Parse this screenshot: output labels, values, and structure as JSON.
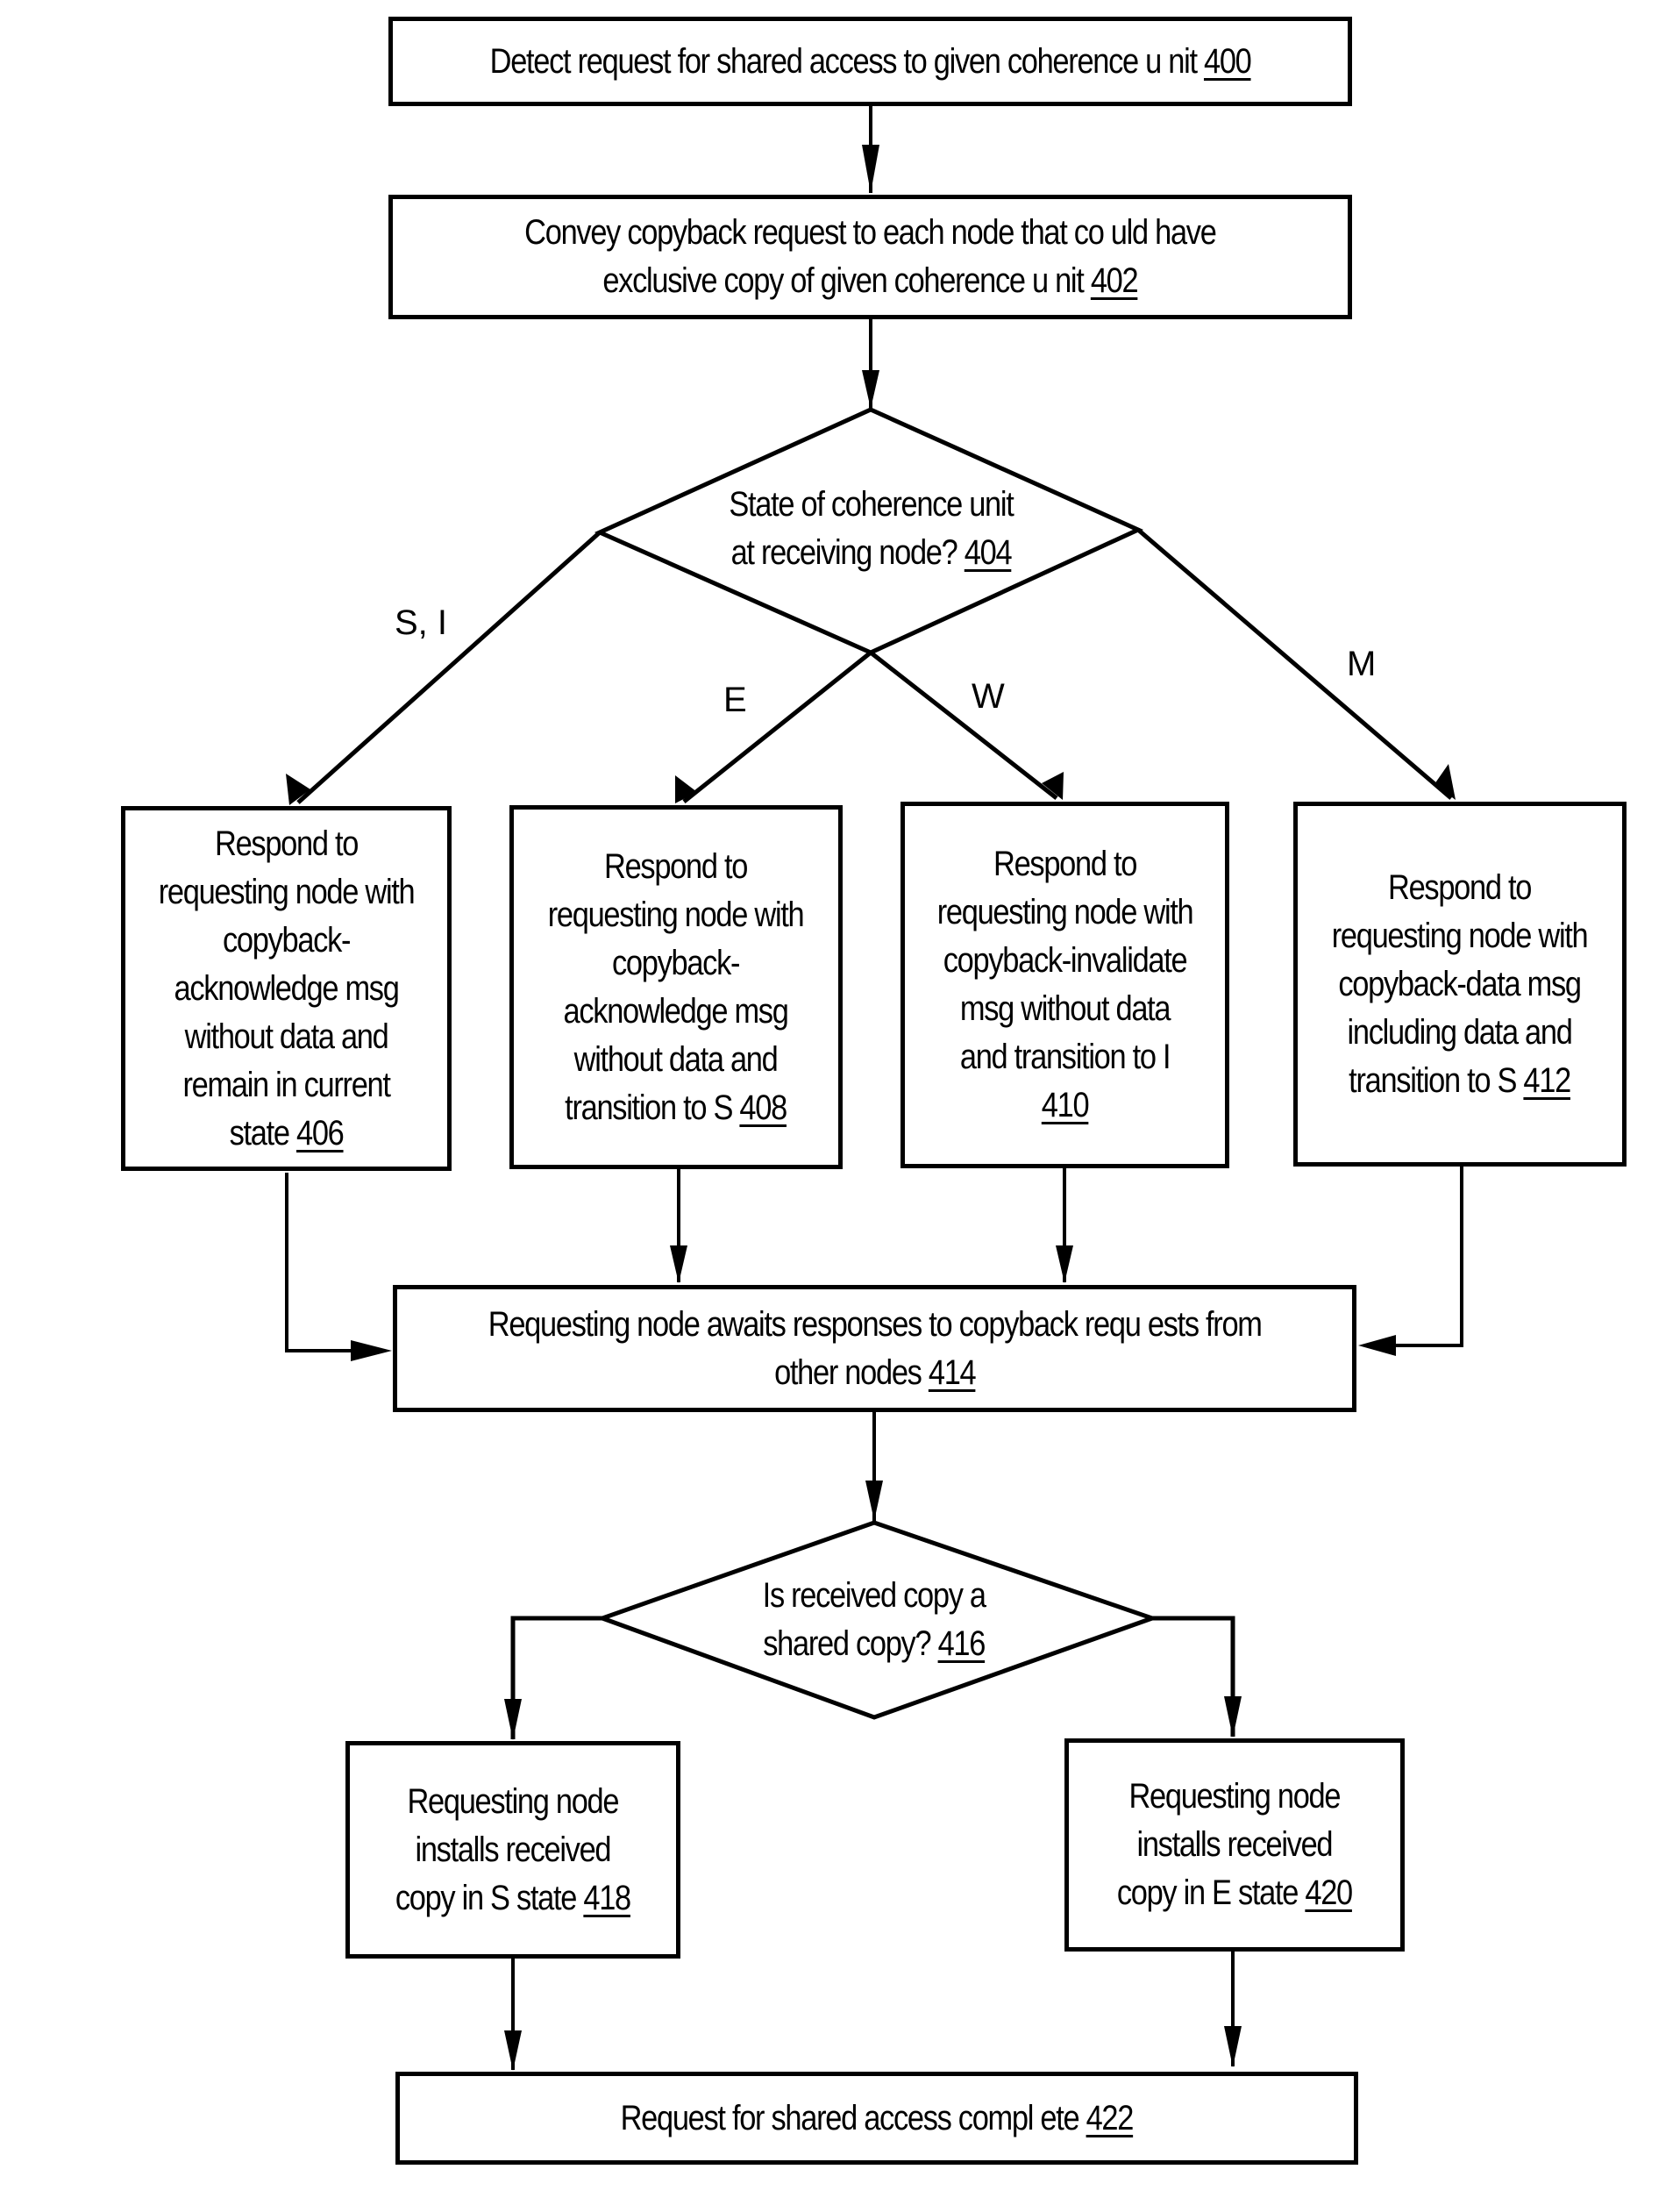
{
  "diagram": {
    "type": "flowchart",
    "nodes": [
      {
        "id": "400",
        "shape": "process",
        "text": "Detect request for shared access to given coherence u nit ",
        "ref": "400"
      },
      {
        "id": "402",
        "shape": "process",
        "text_lines": [
          "Convey copyback request to each node that co uld have",
          "exclusive copy of given coherence u nit "
        ],
        "ref": "402"
      },
      {
        "id": "404",
        "shape": "decision",
        "text_lines": [
          "State of coherence unit",
          "at receiving node? "
        ],
        "ref": "404"
      },
      {
        "id": "406",
        "shape": "process",
        "text_lines": [
          "Respond to",
          "requesting node with",
          "copyback-",
          "acknowledge msg",
          "without data and",
          "remain in current",
          "state "
        ],
        "ref": "406"
      },
      {
        "id": "408",
        "shape": "process",
        "text_lines": [
          "Respond to",
          "requesting node with",
          "copyback-",
          "acknowledge msg",
          "without data and",
          "transition to S "
        ],
        "ref": "408"
      },
      {
        "id": "410",
        "shape": "process",
        "text_lines": [
          "Respond to",
          "requesting node with",
          "copyback-invalidate",
          "msg without data",
          "and transition to I",
          ""
        ],
        "ref": "410"
      },
      {
        "id": "412",
        "shape": "process",
        "text_lines": [
          "Respond to",
          "requesting node with",
          "copyback-data msg",
          "including data and",
          "transition to S "
        ],
        "ref": "412"
      },
      {
        "id": "414",
        "shape": "process",
        "text_lines": [
          "Requesting node awaits responses to copyback requ ests from",
          "other nodes "
        ],
        "ref": "414"
      },
      {
        "id": "416",
        "shape": "decision",
        "text_lines": [
          "Is received copy a",
          "shared copy? "
        ],
        "ref": "416"
      },
      {
        "id": "418",
        "shape": "process",
        "text_lines": [
          "Requesting node",
          "installs received",
          "copy in S state "
        ],
        "ref": "418"
      },
      {
        "id": "420",
        "shape": "process",
        "text_lines": [
          "Requesting node",
          "installs received",
          "copy in E state "
        ],
        "ref": "420"
      },
      {
        "id": "422",
        "shape": "terminal",
        "text": "Request for shared access compl ete ",
        "ref": "422"
      }
    ],
    "edges": [
      {
        "from": "400",
        "to": "402",
        "label": ""
      },
      {
        "from": "402",
        "to": "404",
        "label": ""
      },
      {
        "from": "404",
        "to": "406",
        "label": "S, I"
      },
      {
        "from": "404",
        "to": "408",
        "label": "E"
      },
      {
        "from": "404",
        "to": "410",
        "label": "W"
      },
      {
        "from": "404",
        "to": "412",
        "label": "M"
      },
      {
        "from": "406",
        "to": "414",
        "label": ""
      },
      {
        "from": "408",
        "to": "414",
        "label": ""
      },
      {
        "from": "410",
        "to": "414",
        "label": ""
      },
      {
        "from": "412",
        "to": "414",
        "label": ""
      },
      {
        "from": "414",
        "to": "416",
        "label": ""
      },
      {
        "from": "416",
        "to": "418",
        "label": ""
      },
      {
        "from": "416",
        "to": "420",
        "label": ""
      },
      {
        "from": "418",
        "to": "422",
        "label": ""
      },
      {
        "from": "420",
        "to": "422",
        "label": ""
      }
    ],
    "edge_labels": {
      "si": "S, I",
      "e": "E",
      "w": "W",
      "m": "M"
    },
    "line_color": "#000000",
    "background": "#ffffff"
  }
}
